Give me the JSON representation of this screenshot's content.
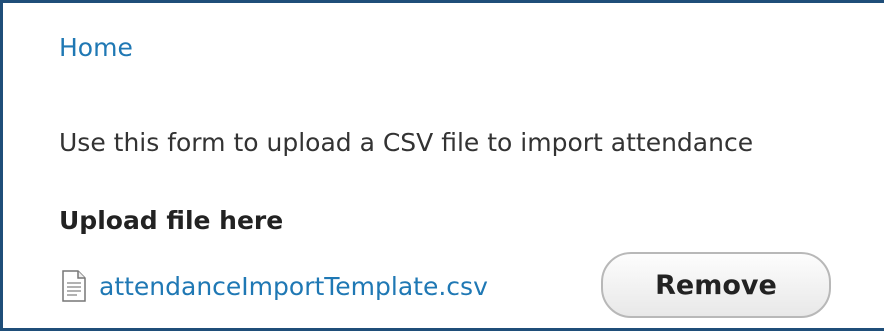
{
  "breadcrumb": {
    "home_label": "Home"
  },
  "form": {
    "description": "Use this form to upload a CSV file to import attendance",
    "upload_label": "Upload file here",
    "file": {
      "icon": "document-icon",
      "name": "attendanceImportTemplate.csv"
    },
    "remove_label": "Remove"
  },
  "colors": {
    "link": "#1f78b4",
    "frame_border": "#1f4e79",
    "text": "#333333"
  }
}
